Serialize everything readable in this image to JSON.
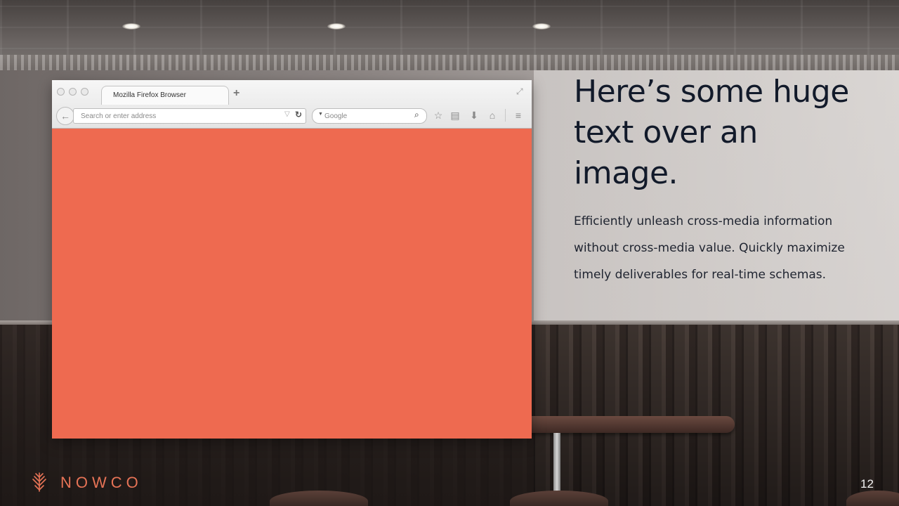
{
  "browser": {
    "tab_title": "Mozilla Firefox Browser",
    "new_tab_symbol": "+",
    "address_placeholder": "Search or enter address",
    "search_placeholder": "Google",
    "content_color": "#ee6a50"
  },
  "slide": {
    "headline": "Here’s some huge text over an image.",
    "body": "Efficiently unleash cross-media information without cross-media value. Quickly maximize timely deliverables for real-time schemas.",
    "brand": "NOWCO",
    "page_number": "12"
  },
  "colors": {
    "accent": "#e67356",
    "headline": "#121a2a"
  },
  "icons": {
    "back": "back-arrow-icon",
    "reload": "reload-icon",
    "search": "magnifier-icon",
    "bookmark": "star-icon",
    "reading_list": "clipboard-icon",
    "downloads": "download-icon",
    "home": "home-icon",
    "menu": "hamburger-menu-icon"
  }
}
